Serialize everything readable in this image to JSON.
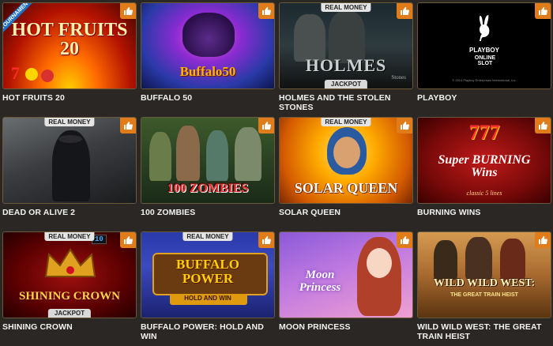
{
  "games": [
    {
      "name": "HOT FRUITS 20",
      "art_title": "HOT FRUITS 20",
      "ribbon": "TOURNAMENT"
    },
    {
      "name": "BUFFALO 50",
      "art_title": "Buffalo50"
    },
    {
      "name": "HOLMES AND THE STOLEN STONES",
      "art_title": "HOLMES",
      "art_sub": "Stones",
      "badge": "REAL MONEY",
      "jackpot": "JACKPOT"
    },
    {
      "name": "PLAYBOY",
      "art_title": "PLAYBOY",
      "art_sub": "ONLINE SLOT",
      "art_small": "© 2014 Playboy Enterprises International, Inc."
    },
    {
      "name": "DEAD OR ALIVE 2",
      "badge": "REAL MONEY"
    },
    {
      "name": "100 ZOMBIES",
      "art_title": "100 ZOMBIES"
    },
    {
      "name": "SOLAR QUEEN",
      "art_title": "SOLAR QUEEN",
      "badge": "REAL MONEY"
    },
    {
      "name": "BURNING WINS",
      "art_title": "777",
      "art_sub": "Super BURNING Wins",
      "art_small": "classic 5 lines"
    },
    {
      "name": "SHINING CROWN",
      "art_title": "SHINING CROWN",
      "badge": "REAL MONEY",
      "jackpot": "JACKPOT",
      "counter": "10"
    },
    {
      "name": "BUFFALO POWER: HOLD AND WIN",
      "art_title": "BUFFALO POWER",
      "art_sub": "HOLD AND WIN",
      "badge": "REAL MONEY"
    },
    {
      "name": "MOON PRINCESS",
      "art_title": "Moon Princess"
    },
    {
      "name": "WILD WILD WEST: THE GREAT TRAIN HEIST",
      "art_title": "WILD WILD WEST:",
      "art_sub": "THE GREAT TRAIN HEIST"
    }
  ],
  "icons": {
    "favorite": "thumbs-up-icon"
  },
  "colors": {
    "accent": "#e07c1a",
    "background": "#2a2724",
    "ribbon": "#1e6fc4"
  }
}
